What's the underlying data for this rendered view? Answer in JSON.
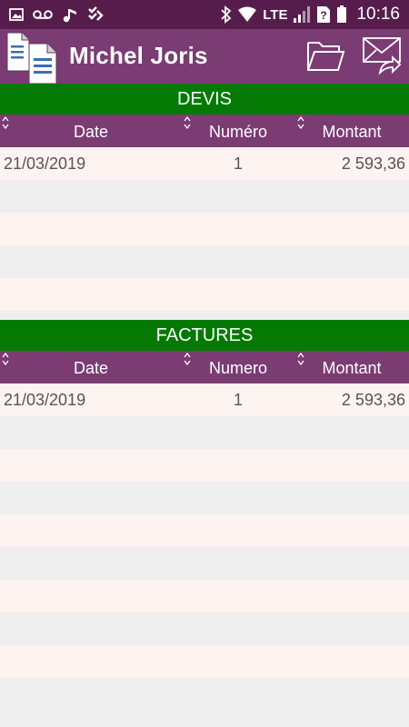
{
  "status_bar": {
    "network": "LTE",
    "time": "10:16",
    "icons": [
      "image-icon",
      "voicemail-icon",
      "music-note-icon",
      "checklist-icon",
      "bluetooth-icon",
      "wifi-icon",
      "signal-icon",
      "unknown-sim-icon",
      "battery-icon"
    ]
  },
  "app_bar": {
    "title": "Michel Joris",
    "icons": [
      "documents-icon",
      "folder-icon",
      "mail-forward-icon"
    ]
  },
  "devis": {
    "title": "DEVIS",
    "columns": [
      "Date",
      "Numéro",
      "Montant"
    ],
    "rows": [
      {
        "date": "21/03/2019",
        "number": "1",
        "amount": "2 593,36"
      }
    ]
  },
  "factures": {
    "title": "FACTURES",
    "columns": [
      "Date",
      "Numero",
      "Montant"
    ],
    "rows": [
      {
        "date": "21/03/2019",
        "number": "1",
        "amount": "2 593,36"
      }
    ]
  },
  "colors": {
    "status_bar": "#561d4c",
    "app_bar": "#7b3b73",
    "section_green": "#047a05",
    "row_light": "#fdf3f0",
    "row_grey": "#eeeeee"
  }
}
